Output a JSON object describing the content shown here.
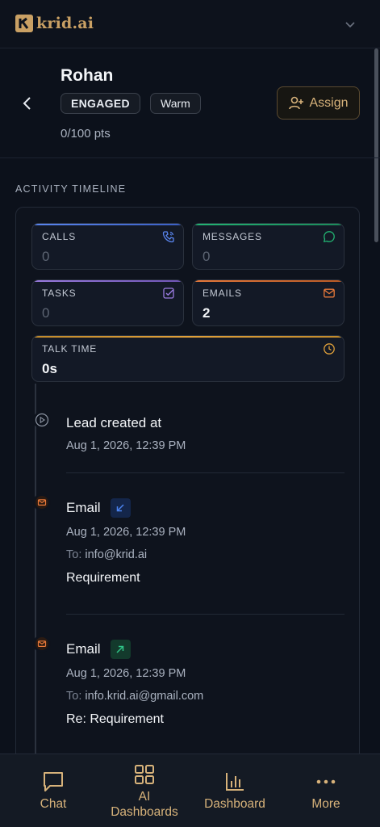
{
  "app": {
    "logo_text": "krid.ai",
    "colors": {
      "accent": "#d7b27a",
      "background": "#0c111b"
    }
  },
  "header": {
    "lead_name": "Rohan",
    "status_badge": "ENGAGED",
    "temperature_badge": "Warm",
    "points": "0/100 pts",
    "assign_label": "Assign"
  },
  "activity": {
    "section_title": "ACTIVITY TIMELINE",
    "stats": {
      "calls": {
        "label": "CALLS",
        "value": "0",
        "icon": "phone-icon",
        "color": "#4b7bec"
      },
      "messages": {
        "label": "MESSAGES",
        "value": "0",
        "icon": "message-circle-icon",
        "color": "#22b573"
      },
      "tasks": {
        "label": "TASKS",
        "value": "0",
        "icon": "checkbox-icon",
        "color": "#9a7be0"
      },
      "emails": {
        "label": "EMAILS",
        "value": "2",
        "icon": "mail-icon",
        "color": "#e8793a"
      },
      "talk_time": {
        "label": "TALK TIME",
        "value": "0s",
        "icon": "clock-icon",
        "color": "#e0a03a"
      }
    },
    "timeline": [
      {
        "title": "Lead created at",
        "time": "Aug 1, 2026, 12:39 PM"
      },
      {
        "title": "Email",
        "direction": "incoming",
        "time": "Aug 1, 2026, 12:39 PM",
        "to_label": "To:",
        "to": "info@krid.ai",
        "subject": "Requirement"
      },
      {
        "title": "Email",
        "direction": "outgoing",
        "time": "Aug 1, 2026, 12:39 PM",
        "to_label": "To:",
        "to": "info.krid.ai@gmail.com",
        "subject": "Re: Requirement"
      }
    ]
  },
  "bottom_nav": {
    "items": [
      {
        "label": "Chat",
        "icon": "chat-icon"
      },
      {
        "label": "AI Dashboards",
        "line1": "AI",
        "line2": "Dashboards",
        "icon": "grid-icon"
      },
      {
        "label": "Dashboard",
        "icon": "bar-chart-icon"
      },
      {
        "label": "More",
        "icon": "more-dots-icon"
      }
    ]
  }
}
